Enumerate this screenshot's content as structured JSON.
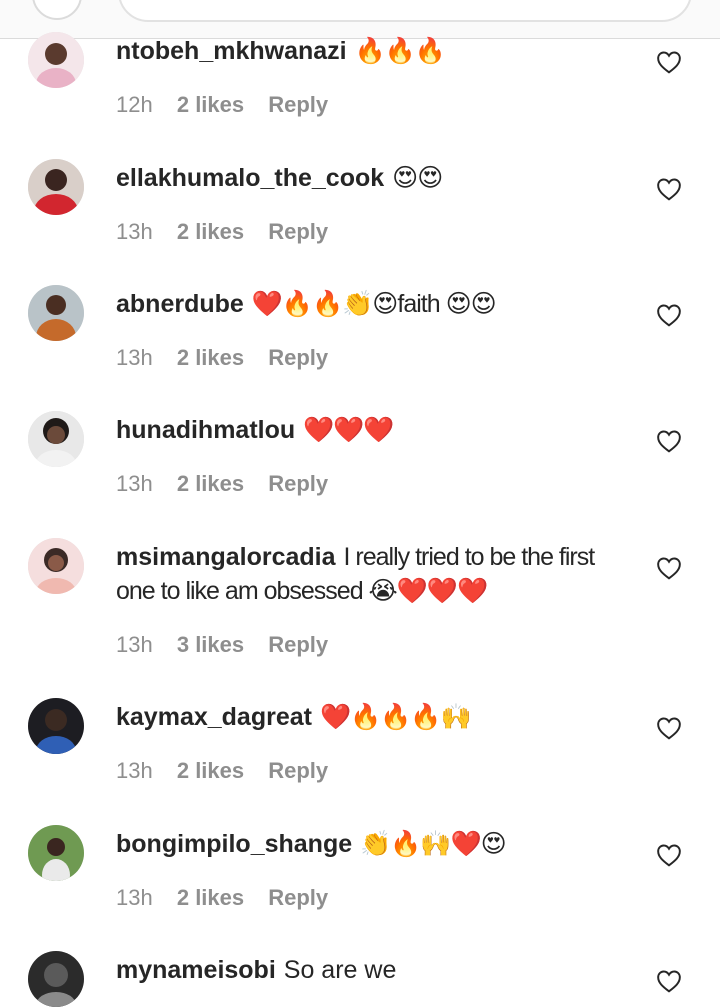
{
  "comments": [
    {
      "username": "ntobeh_mkhwanazi",
      "text": "",
      "emoji": "🔥🔥🔥",
      "time": "12h",
      "likes": "2 likes",
      "reply": "Reply",
      "avatar_color": "#e9b2c6"
    },
    {
      "username": "ellakhumalo_the_cook",
      "text": "",
      "emoji": "😍😍",
      "time": "13h",
      "likes": "2 likes",
      "reply": "Reply",
      "avatar_color": "#d2262f"
    },
    {
      "username": "abnerdube",
      "text": "❤️🔥🔥👏😍faith 😍😍",
      "emoji": "",
      "time": "13h",
      "likes": "2 likes",
      "reply": "Reply",
      "avatar_color": "#c56a2b"
    },
    {
      "username": "hunadihmatlou",
      "text": "",
      "emoji": "❤️❤️❤️",
      "time": "13h",
      "likes": "2 likes",
      "reply": "Reply",
      "avatar_color": "#b7b7b7"
    },
    {
      "username": "msimangalorcadia",
      "text": "I really tried to be the first one to like am obsessed 😭❤️❤️❤️",
      "emoji": "",
      "time": "13h",
      "likes": "3 likes",
      "reply": "Reply",
      "avatar_color": "#f0b9b0"
    },
    {
      "username": "kaymax_dagreat",
      "text": "",
      "emoji": "❤️🔥🔥🔥🙌",
      "time": "13h",
      "likes": "2 likes",
      "reply": "Reply",
      "avatar_color": "#2f5fb5"
    },
    {
      "username": "bongimpilo_shange",
      "text": "",
      "emoji": "👏🔥🙌❤️😍",
      "time": "13h",
      "likes": "2 likes",
      "reply": "Reply",
      "avatar_color": "#7aa35a"
    },
    {
      "username": "mynameisobi",
      "text": "So are we",
      "emoji": "",
      "time": "",
      "likes": "",
      "reply": "",
      "avatar_color": "#2b2b2b"
    }
  ],
  "icons": {
    "like": "heart-outline-icon"
  }
}
